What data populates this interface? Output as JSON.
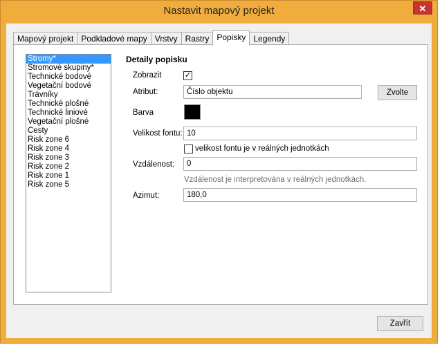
{
  "window": {
    "title": "Nastavit mapový projekt",
    "close_label": "✕"
  },
  "tabs": [
    {
      "label": "Mapový projekt"
    },
    {
      "label": "Podkladové mapy"
    },
    {
      "label": "Vrstvy"
    },
    {
      "label": "Rastry"
    },
    {
      "label": "Popisky"
    },
    {
      "label": "Legendy"
    }
  ],
  "layers": [
    {
      "label": "Stromy*"
    },
    {
      "label": "Stromové skupiny*"
    },
    {
      "label": "Technické bodové"
    },
    {
      "label": "Vegetační bodové"
    },
    {
      "label": "Trávníky"
    },
    {
      "label": "Technické plošné"
    },
    {
      "label": "Technické liniové"
    },
    {
      "label": "Vegetační plošné"
    },
    {
      "label": "Cesty"
    },
    {
      "label": "Risk zone 6"
    },
    {
      "label": "Risk zone 4"
    },
    {
      "label": "Risk zone 3"
    },
    {
      "label": "Risk zone 2"
    },
    {
      "label": "Risk zone 1"
    },
    {
      "label": "Risk zone 5"
    }
  ],
  "details": {
    "title": "Detaily popisku",
    "show_label": "Zobrazit",
    "show_checked": "✓",
    "attribute_label": "Atribut:",
    "attribute_value": "Číslo objektu",
    "choose_button": "Zvolte",
    "color_label": "Barva",
    "color_value": "#000000",
    "font_size_label": "Velikost fontu:",
    "font_size_value": "10",
    "real_units_label": "velikost fontu je v reálných jednotkách",
    "distance_label": "Vzdálenost:",
    "distance_value": "0",
    "distance_hint": "Vzdálenost je interpretována v reálných jednotkách.",
    "azimuth_label": "Azimut:",
    "azimuth_value": "180,0"
  },
  "footer": {
    "close_button": "Zavřít"
  }
}
